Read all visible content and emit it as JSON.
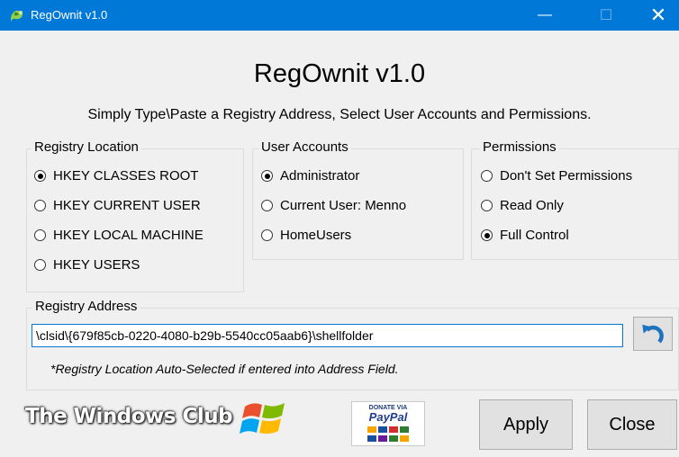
{
  "window": {
    "title": "RegOwnit v1.0",
    "minimize_glyph": "—",
    "maximize_glyph": "☐",
    "close_glyph": "✕"
  },
  "header": {
    "title": "RegOwnit v1.0",
    "subtitle": "Simply Type\\Paste a Registry Address, Select User Accounts and Permissions."
  },
  "registry_location": {
    "legend": "Registry Location",
    "options": [
      {
        "label": "HKEY CLASSES ROOT",
        "checked": true
      },
      {
        "label": "HKEY CURRENT USER",
        "checked": false
      },
      {
        "label": "HKEY LOCAL MACHINE",
        "checked": false
      },
      {
        "label": "HKEY USERS",
        "checked": false
      }
    ]
  },
  "user_accounts": {
    "legend": "User Accounts",
    "options": [
      {
        "label": "Administrator",
        "checked": true
      },
      {
        "label": "Current User: Menno",
        "checked": false
      },
      {
        "label": "HomeUsers",
        "checked": false
      }
    ]
  },
  "permissions": {
    "legend": "Permissions",
    "options": [
      {
        "label": "Don't Set Permissions",
        "checked": false
      },
      {
        "label": "Read Only",
        "checked": false
      },
      {
        "label": "Full Control",
        "checked": true
      }
    ]
  },
  "address": {
    "legend": "Registry Address",
    "value": "\\clsid\\{679f85cb-0220-4080-b29b-5540cc05aab6}\\shellfolder",
    "note": "*Registry Location Auto-Selected if entered into Address Field."
  },
  "footer": {
    "logo_text": "The Windows Club",
    "paypal_donate": "DONATE VIA",
    "paypal_brand": "PayPal",
    "apply_label": "Apply",
    "close_label": "Close"
  },
  "colors": {
    "titlebar": "#0078d7",
    "background": "#f0f0f0",
    "input_focus_border": "#0078d7",
    "undo_arrow": "#1e73be"
  },
  "icons": [
    "app-icon",
    "undo-icon",
    "windows-flag-icon"
  ]
}
